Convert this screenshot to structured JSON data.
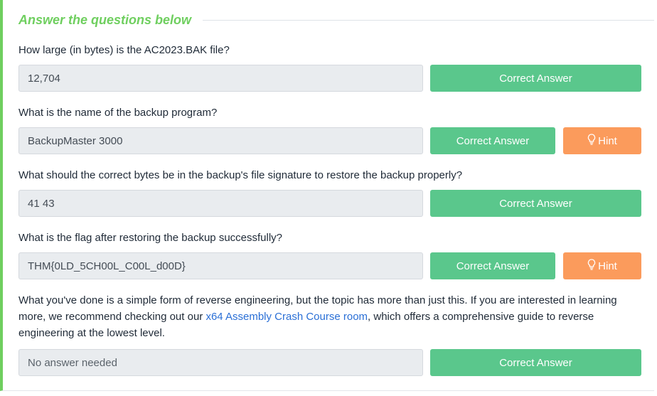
{
  "header": {
    "title": "Answer the questions below"
  },
  "questions": [
    {
      "text": "How large (in bytes) is the AC2023.BAK file?",
      "answer": "12,704",
      "button": "Correct Answer"
    },
    {
      "text": "What is the name of the backup program?",
      "answer": "BackupMaster 3000",
      "button": "Correct Answer",
      "hint": "Hint"
    },
    {
      "text": "What should the correct bytes be in the backup's file signature to restore the backup properly?",
      "answer": "41 43",
      "button": "Correct Answer"
    },
    {
      "text": "What is the flag after restoring the backup successfully?",
      "answer": "THM{0LD_5CH00L_C00L_d00D}",
      "button": "Correct Answer",
      "hint": "Hint"
    }
  ],
  "final": {
    "text_before": "What you've done is a simple form of reverse engineering, but the topic has more than just this. If you are interested in learning more, we recommend checking out our ",
    "link": "x64 Assembly Crash Course room",
    "text_after": ", which offers a comprehensive guide to reverse engineering at the lowest level.",
    "answer": "No answer needed",
    "button": "Correct Answer"
  },
  "colors": {
    "accent": "#6fcf5f",
    "correct": "#5ac78c",
    "hint": "#fb9b5c",
    "link": "#2a6fd6"
  },
  "icons": {
    "hint": "lightbulb-icon"
  }
}
